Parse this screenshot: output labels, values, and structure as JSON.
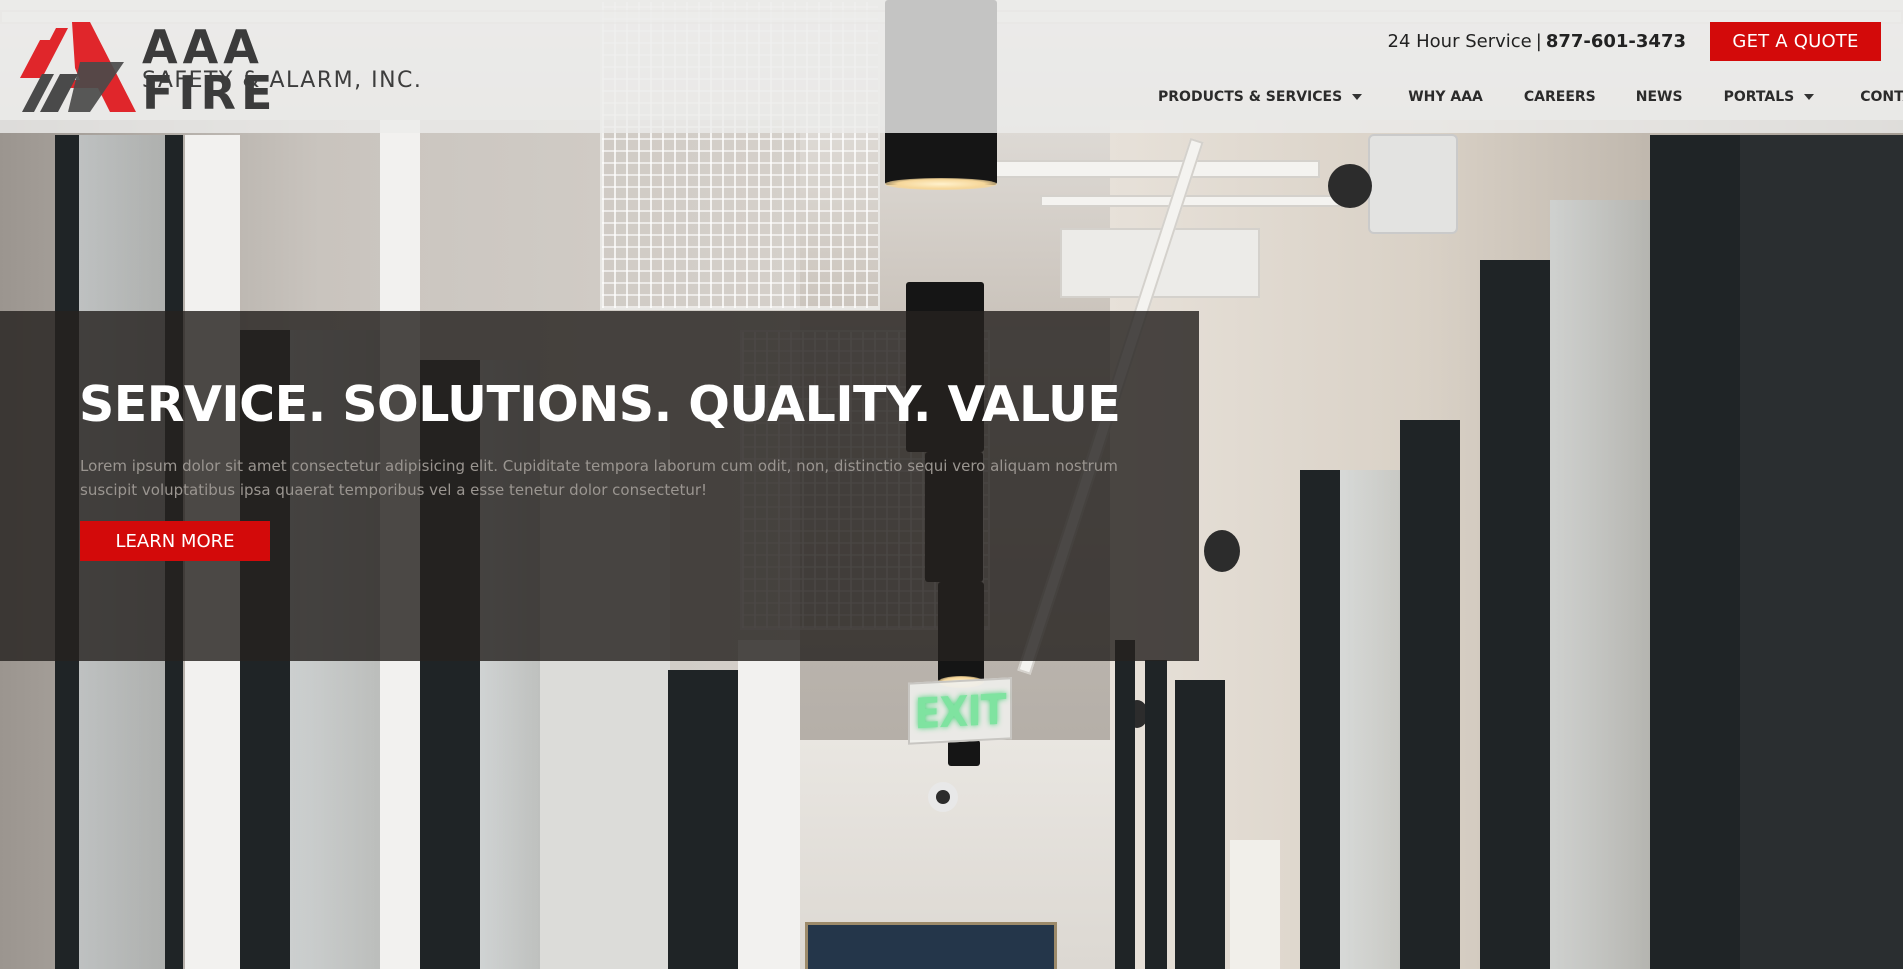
{
  "brand": {
    "name": "AAA FIRE",
    "tagline": "SAFETY & ALARM, INC.",
    "accent_color": "#d30a0a",
    "text_color": "#3b3b3b",
    "logo_icon": "triangle-stripes-logo-icon"
  },
  "topbar": {
    "service_label": "24 Hour Service",
    "separator": "|",
    "phone": "877-601-3473",
    "quote_button": "GET A QUOTE"
  },
  "nav": {
    "items": [
      {
        "label": "PRODUCTS & SERVICES",
        "has_dropdown": true
      },
      {
        "label": "WHY AAA",
        "has_dropdown": false
      },
      {
        "label": "CAREERS",
        "has_dropdown": false
      },
      {
        "label": "NEWS",
        "has_dropdown": false
      },
      {
        "label": "PORTALS",
        "has_dropdown": true
      },
      {
        "label": "CONTACT US",
        "has_dropdown": false
      }
    ]
  },
  "hero": {
    "title": "SERVICE. SOLUTIONS. QUALITY. VALUE",
    "body": "Lorem ipsum dolor sit amet consectetur adipisicing elit. Cupiditate tempora laborum cum odit, non, distinctio sequi vero aliquam nostrum suscipit voluptatibus ipsa quaerat temporibus vel a esse tenetur dolor consectetur!",
    "cta": "LEARN MORE",
    "background": "office-hallway-photo",
    "exit_sign": "EXIT"
  }
}
